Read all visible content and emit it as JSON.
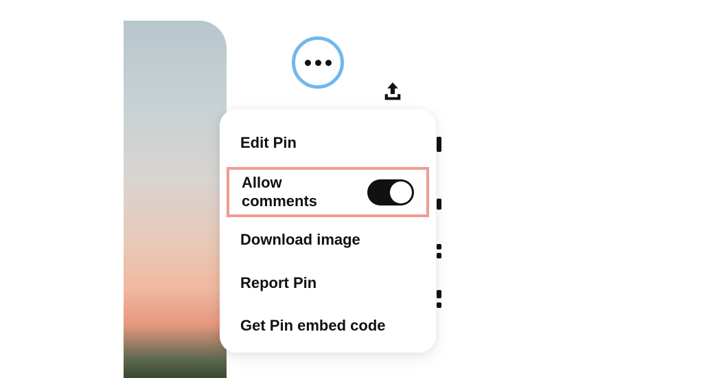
{
  "menu": {
    "edit_pin": "Edit Pin",
    "allow_comments": "Allow comments",
    "download_image": "Download image",
    "report_pin": "Report Pin",
    "get_embed": "Get Pin embed code"
  },
  "toggle": {
    "allow_comments_on": true
  },
  "icons": {
    "more": "more-icon",
    "upload": "upload-icon"
  },
  "colors": {
    "highlight_border": "#ef9b93",
    "focus_ring": "#6fb8ed"
  }
}
